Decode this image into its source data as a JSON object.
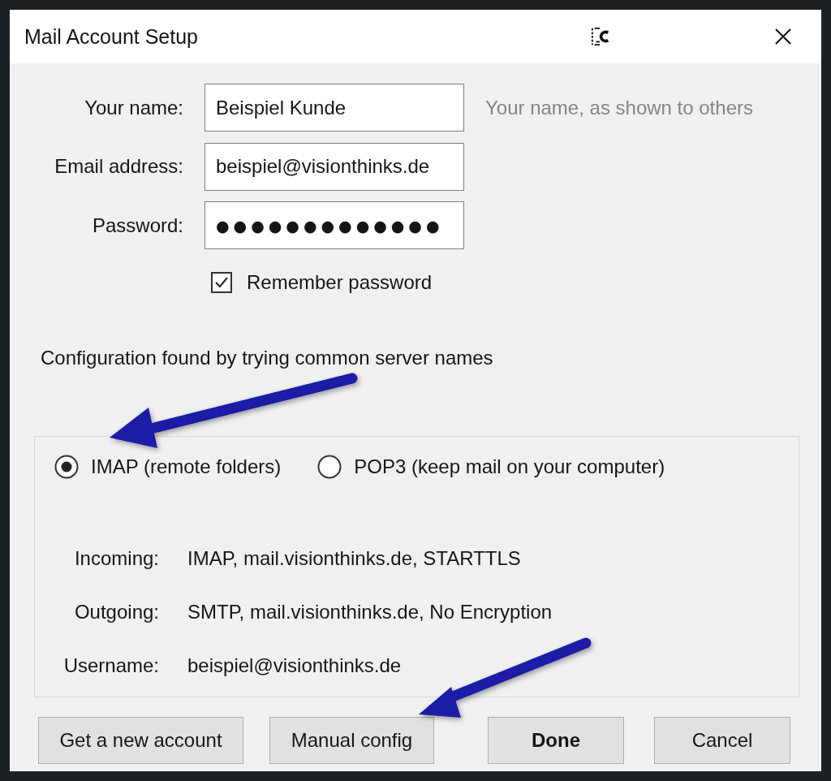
{
  "window": {
    "title": "Mail Account Setup"
  },
  "fields": [
    {
      "label": "Your name:",
      "value": "Beispiel Kunde",
      "hint": "Your name, as shown to others"
    },
    {
      "label": "Email address:",
      "value": "beispiel@visionthinks.de"
    },
    {
      "label": "Password:",
      "value": "●●●●●●●●●●●●●"
    }
  ],
  "remember_password": {
    "label": "Remember password",
    "checked": true
  },
  "status": "Configuration found by trying common server names",
  "protocols": [
    {
      "label": "IMAP (remote folders)",
      "selected": true
    },
    {
      "label": "POP3 (keep mail on your computer)",
      "selected": false
    }
  ],
  "server_info": [
    {
      "label": "Incoming:",
      "value": "IMAP, mail.visionthinks.de, STARTTLS"
    },
    {
      "label": "Outgoing:",
      "value": "SMTP, mail.visionthinks.de, No Encryption"
    },
    {
      "label": "Username:",
      "value": "beispiel@visionthinks.de"
    }
  ],
  "buttons": [
    {
      "label": "Get a new account",
      "default": false
    },
    {
      "label": "Manual config",
      "default": false
    },
    {
      "label": "Done",
      "default": true
    },
    {
      "label": "Cancel",
      "default": false
    }
  ]
}
